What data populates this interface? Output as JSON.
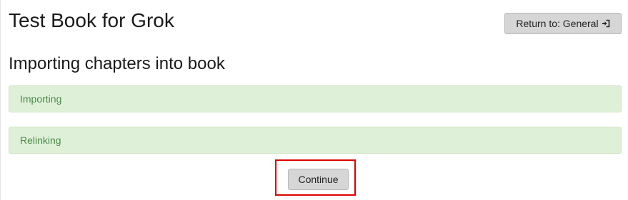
{
  "header": {
    "book_title": "Test Book for Grok",
    "return_label": "Return to: General",
    "return_icon": "sign-in-icon"
  },
  "main": {
    "section_title": "Importing chapters into book",
    "statuses": [
      {
        "label": "Importing",
        "color": "#dff0d8"
      },
      {
        "label": "Relinking",
        "color": "#dff0d8"
      }
    ],
    "continue_label": "Continue",
    "highlight_color": "#e00000"
  }
}
